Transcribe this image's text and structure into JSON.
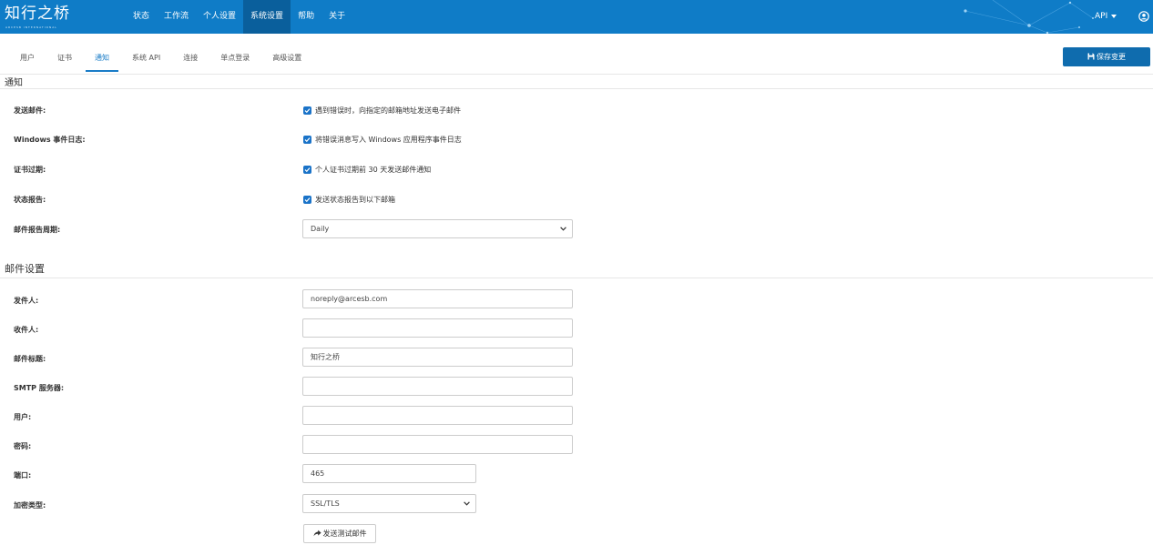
{
  "app": {
    "logo_text": "知行之桥",
    "logo_subtext": "ARCESB INTERNATIONAL"
  },
  "nav": {
    "items": [
      {
        "label": "状态"
      },
      {
        "label": "工作流"
      },
      {
        "label": "个人设置"
      },
      {
        "label": "系统设置",
        "active": true
      },
      {
        "label": "帮助"
      },
      {
        "label": "关于"
      }
    ],
    "api_label": "API",
    "user_icon": "user-circle-icon"
  },
  "tabs": [
    {
      "label": "用户"
    },
    {
      "label": "证书"
    },
    {
      "label": "通知",
      "active": true
    },
    {
      "label": "系统 API"
    },
    {
      "label": "连接"
    },
    {
      "label": "单点登录"
    },
    {
      "label": "高级设置"
    }
  ],
  "toolbar": {
    "save_label": "保存变更",
    "save_icon": "floppy-disk-icon"
  },
  "notifications": {
    "title": "通知",
    "send_email": {
      "label": "发送邮件:",
      "checked": true,
      "text": "遇到错误时，向指定的邮箱地址发送电子邮件"
    },
    "windows_log": {
      "label": "Windows 事件日志:",
      "checked": true,
      "text": "将错误消息写入 Windows 应用程序事件日志"
    },
    "cert_expiry": {
      "label": "证书过期:",
      "checked": true,
      "text": "个人证书过期前 30 天发送邮件通知"
    },
    "status_report": {
      "label": "状态报告:",
      "checked": true,
      "text": "发送状态报告到以下邮箱"
    },
    "report_period": {
      "label": "邮件报告周期:",
      "value": "Daily"
    }
  },
  "mail": {
    "title": "邮件设置",
    "sender": {
      "label": "发件人:",
      "value": "noreply@arcesb.com"
    },
    "recipient": {
      "label": "收件人:",
      "value": ""
    },
    "subject": {
      "label": "邮件标题:",
      "value": "知行之桥"
    },
    "smtp": {
      "label": "SMTP 服务器:",
      "value": ""
    },
    "user": {
      "label": "用户:",
      "value": ""
    },
    "password": {
      "label": "密码:",
      "value": ""
    },
    "port": {
      "label": "端口:",
      "value": "465"
    },
    "encryption": {
      "label": "加密类型:",
      "value": "SSL/TLS"
    },
    "test_button": {
      "label": "发送测试邮件",
      "icon": "share-arrow-icon"
    }
  },
  "colors": {
    "navbar": "#0f7cc7",
    "nav_active": "#0a5f9c",
    "accent": "#1a7cc7",
    "save_button": "#0f6cae"
  }
}
